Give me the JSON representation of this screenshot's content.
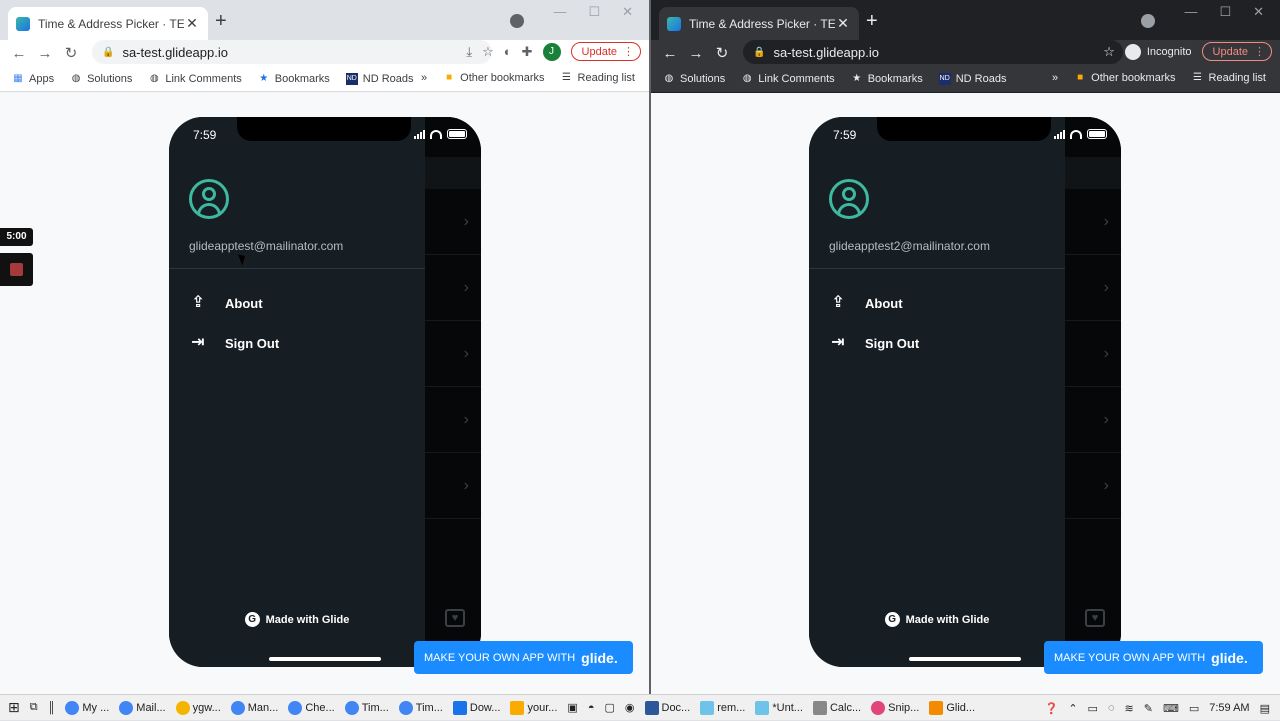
{
  "windows": [
    {
      "tab_title": "Time & Address Picker · TEST · M",
      "url": "sa-test.glideapp.io",
      "update_label": "Update",
      "profile_initial": "J",
      "bookmarks": [
        "Apps",
        "Solutions",
        "Link Comments",
        "Bookmarks",
        "ND Roads"
      ],
      "other_bookmarks": "Other bookmarks",
      "reading_list": "Reading list",
      "email": "glideapptest@mailinator.com"
    },
    {
      "tab_title": "Time & Address Picker · TEST · M",
      "url": "sa-test.glideapp.io",
      "update_label": "Update",
      "incognito_label": "Incognito",
      "bookmarks": [
        "Solutions",
        "Link Comments",
        "Bookmarks",
        "ND Roads"
      ],
      "other_bookmarks": "Other bookmarks",
      "reading_list": "Reading list",
      "email": "glideapptest2@mailinator.com"
    }
  ],
  "phone": {
    "time": "7:59",
    "menu": [
      "About",
      "Sign Out"
    ],
    "made_with": "Made with Glide",
    "banner_text": "MAKE YOUR OWN APP WITH",
    "banner_brand": "glide."
  },
  "recorder": {
    "timer": "5:00"
  },
  "taskbar": {
    "items": [
      "My ...",
      "Mail...",
      "ygw...",
      "Man...",
      "Che...",
      "Tim...",
      "Tim...",
      "Dow...",
      "your...",
      "Doc...",
      "rem...",
      "*Unt...",
      "Calc...",
      "Snip...",
      "Glid..."
    ],
    "clock": "7:59 AM"
  },
  "colors": {
    "accent_teal": "#3fb8a0",
    "drawer_bg": "#161e24",
    "glide_blue": "#1a8cff",
    "update_red": "#d93025"
  }
}
